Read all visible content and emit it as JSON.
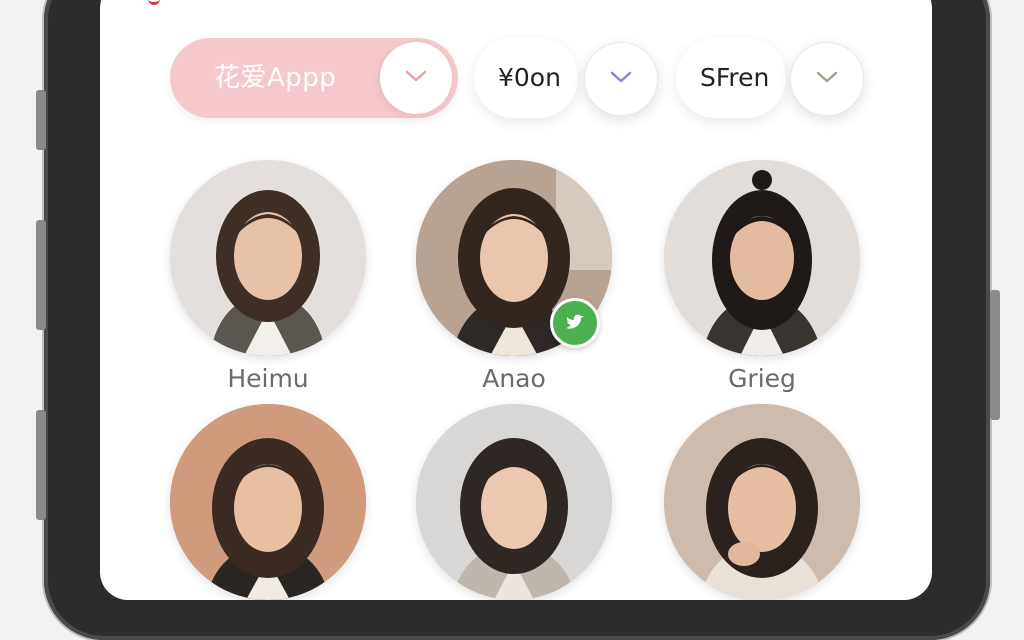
{
  "filters": {
    "primary": {
      "label": "花爱Appp",
      "color": "#f5c9cb"
    },
    "price": {
      "label": "¥0on",
      "chevron_color": "#8a86c8"
    },
    "gender": {
      "label": "SFren",
      "chevron_color": "#a8a08a"
    }
  },
  "profiles": [
    {
      "name": "Heimu",
      "verified": false,
      "icon": "avatar-portrait"
    },
    {
      "name": "Anao",
      "verified": true,
      "badge_icon": "twitter-bird-icon",
      "badge_color": "#4caf50"
    },
    {
      "name": "Grieg",
      "verified": false
    },
    {
      "name": "",
      "verified": false
    },
    {
      "name": "",
      "verified": false
    },
    {
      "name": "",
      "verified": false
    }
  ]
}
